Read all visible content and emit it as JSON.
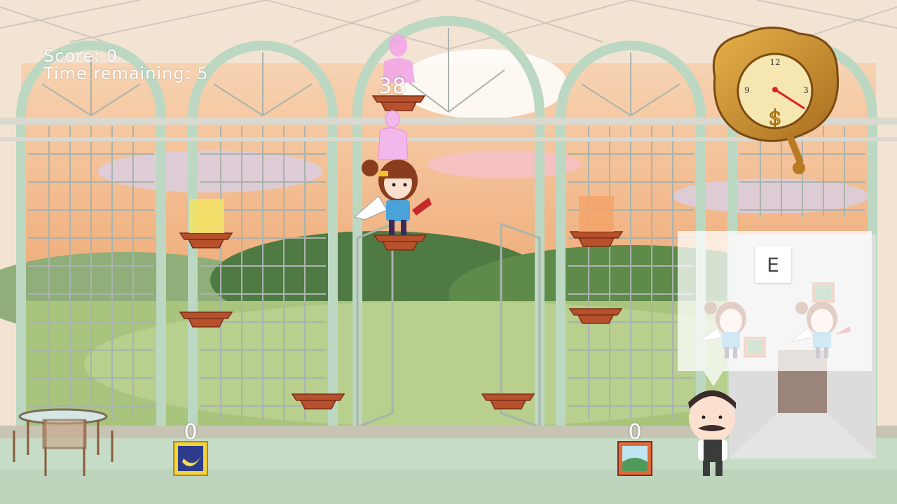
{
  "hud": {
    "score_text": "Score: 0",
    "time_text": "Time remaining: 5"
  },
  "pedestal": {
    "value": "38"
  },
  "items": [
    {
      "name": "banana painting",
      "count": "0"
    },
    {
      "name": "landscape painting",
      "count": "0"
    }
  ],
  "hint": {
    "key": "E"
  },
  "colors": {
    "window_frame": "#bcd8c2",
    "wall": "#f3e3d3",
    "floor": "#c7dcc6",
    "shelf": "#b6512c",
    "sky": "#f0b07e",
    "hill": "#6f9a4f"
  },
  "icons": {
    "clock": "gold-clock-icon",
    "banana": "banana-painting-icon",
    "landscape": "landscape-painting-icon"
  }
}
